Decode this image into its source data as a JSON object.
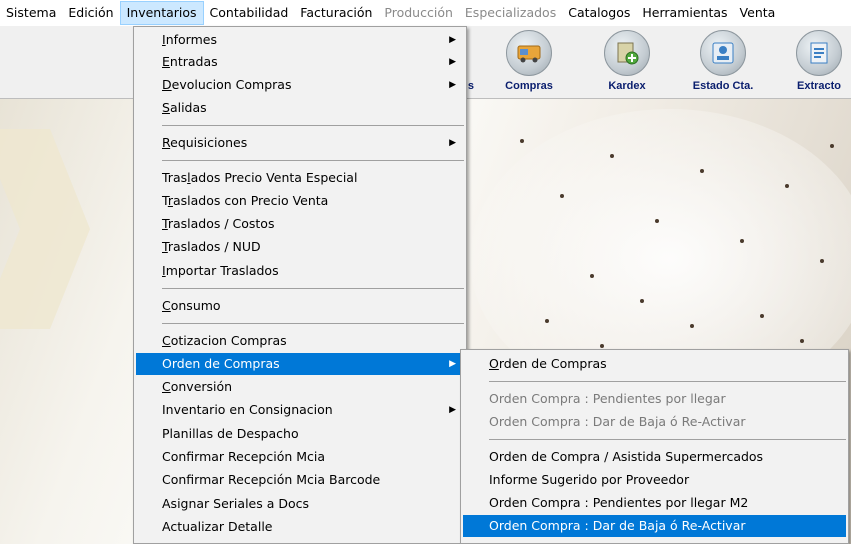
{
  "menubar": {
    "items": [
      {
        "label": "Sistema",
        "state": "normal"
      },
      {
        "label": "Edición",
        "state": "normal"
      },
      {
        "label": "Inventarios",
        "state": "active"
      },
      {
        "label": "Contabilidad",
        "state": "normal"
      },
      {
        "label": "Facturación",
        "state": "normal"
      },
      {
        "label": "Producción",
        "state": "disabled"
      },
      {
        "label": "Especializados",
        "state": "disabled"
      },
      {
        "label": "Catalogos",
        "state": "normal"
      },
      {
        "label": "Herramientas",
        "state": "normal"
      },
      {
        "label": "Venta",
        "state": "normal"
      }
    ]
  },
  "toolbar": {
    "buttons": [
      {
        "label": "s"
      },
      {
        "label": "Compras",
        "icon": "truck-icon",
        "color": "#e8a53a"
      },
      {
        "label": "Kardex",
        "icon": "document-add-icon",
        "color": "#4fa83d"
      },
      {
        "label": "Estado Cta.",
        "icon": "id-card-icon",
        "color": "#3a7fc4"
      },
      {
        "label": "Extracto",
        "icon": "document-icon",
        "color": "#3a7fc4"
      }
    ]
  },
  "inventarios_menu": {
    "informes": {
      "pre": "",
      "u": "I",
      "post": "nformes"
    },
    "entradas": {
      "pre": "",
      "u": "E",
      "post": "ntradas"
    },
    "devolucion": {
      "pre": "",
      "u": "D",
      "post": "evolucion Compras"
    },
    "salidas": {
      "pre": "",
      "u": "S",
      "post": "alidas"
    },
    "requisiciones": {
      "pre": "",
      "u": "R",
      "post": "equisiciones"
    },
    "traslados_especial": {
      "pre": "Tras",
      "u": "l",
      "post": "ados  Precio Venta Especial"
    },
    "traslados_precio": {
      "pre": "T",
      "u": "r",
      "post": "aslados con Precio Venta"
    },
    "traslados_costos": {
      "pre": "",
      "u": "T",
      "post": "raslados  / Costos"
    },
    "traslados_nud": {
      "pre": "",
      "u": "T",
      "post": "raslados / NUD"
    },
    "importar": {
      "pre": "",
      "u": "I",
      "post": "mportar Traslados"
    },
    "consumo": {
      "pre": "",
      "u": "C",
      "post": "onsumo"
    },
    "cotizacion": {
      "pre": "",
      "u": "C",
      "post": "otizacion Compras"
    },
    "orden": {
      "pre": "",
      "u": "O",
      "post": "rden de Compras"
    },
    "conversion": {
      "pre": "",
      "u": "C",
      "post": "onversión"
    },
    "consignacion": {
      "label": "Inventario en Consignacion"
    },
    "planillas": {
      "label": "Planillas de Despacho"
    },
    "confirmar": {
      "label": "Confirmar Recepción Mcia"
    },
    "confirmar_barcode": {
      "label": "Confirmar Recepción Mcia Barcode"
    },
    "seriales": {
      "label": "Asignar Seriales a Docs"
    },
    "actualizar": {
      "label": "Actualizar Detalle"
    }
  },
  "orden_menu": {
    "orden_compras": {
      "pre": "",
      "u": "O",
      "post": "rden de Compras"
    },
    "pendientes": {
      "label": "Orden Compra : Pendientes  por llegar"
    },
    "dar_baja_disabled": {
      "label": "Orden Compra : Dar de  Baja ó  Re-Activar"
    },
    "asistida": {
      "label": "Orden de Compra / Asistida Supermercados"
    },
    "sugerido": {
      "label": "Informe Sugerido por Proveedor"
    },
    "pendientes_m2": {
      "label": "Orden Compra : Pendientes por llegar M2"
    },
    "dar_baja": {
      "label": "Orden Compra : Dar de  Baja ó  Re-Activar"
    }
  }
}
